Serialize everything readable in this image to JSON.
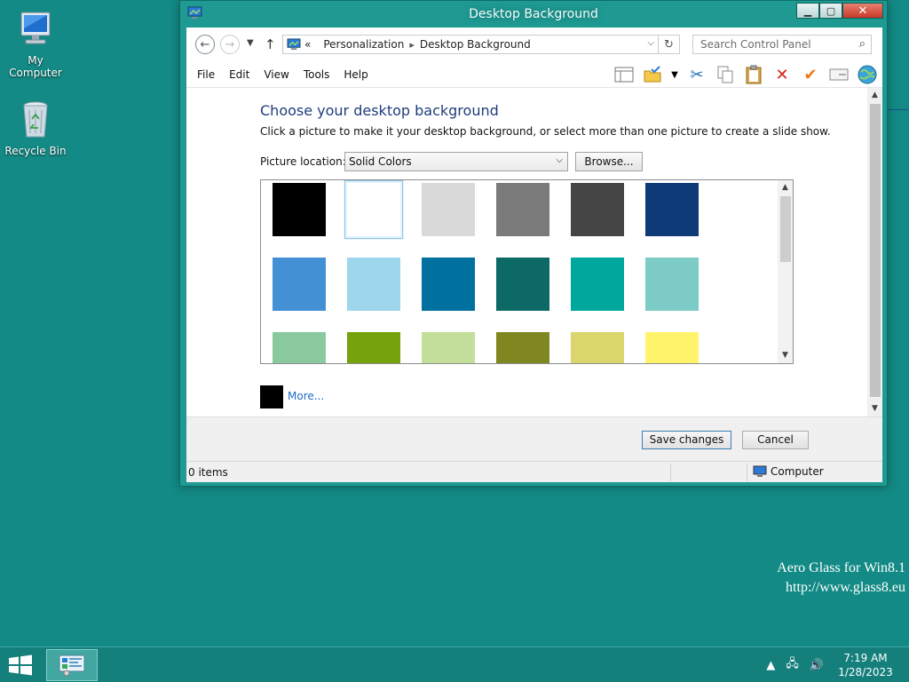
{
  "desktop": {
    "icons": [
      {
        "label": "My Computer"
      },
      {
        "label": "Recycle Bin"
      }
    ],
    "watermark": {
      "line1": "Aero Glass for Win8.1",
      "line2": "http://www.glass8.eu"
    }
  },
  "window": {
    "title": "Desktop Background",
    "address": {
      "prefix": "«",
      "crumbs": [
        "Personalization",
        "Desktop Background"
      ]
    },
    "search_placeholder": "Search Control Panel",
    "menu": [
      "File",
      "Edit",
      "View",
      "Tools",
      "Help"
    ],
    "content": {
      "heading": "Choose your desktop background",
      "description": "Click a picture to make it your desktop background, or select more than one picture to create a slide show.",
      "picture_location_label": "Picture location:",
      "picture_location_value": "Solid Colors",
      "browse_label": "Browse...",
      "more_label": "More...",
      "swatches": [
        [
          "#000000",
          "#ffffff",
          "#d9d9d9",
          "#7a7a7a",
          "#454545",
          "#0e3a77"
        ],
        [
          "#4390d4",
          "#9ed6ec",
          "#00709f",
          "#0d6966",
          "#00a79d",
          "#7ccbc6"
        ],
        [
          "#8ac99e",
          "#76a30c",
          "#c4de9c",
          "#808620",
          "#dad56c",
          "#fff36c"
        ]
      ],
      "selected_swatch": "#ffffff"
    },
    "footer": {
      "save_label": "Save changes",
      "cancel_label": "Cancel"
    },
    "status": {
      "items": "0 items",
      "location": "Computer"
    }
  },
  "taskbar": {
    "time": "7:19 AM",
    "date": "1/28/2023"
  },
  "colors": {
    "desktop": "#138a85",
    "accent": "#1e3d7b",
    "link": "#1a6dc5"
  }
}
